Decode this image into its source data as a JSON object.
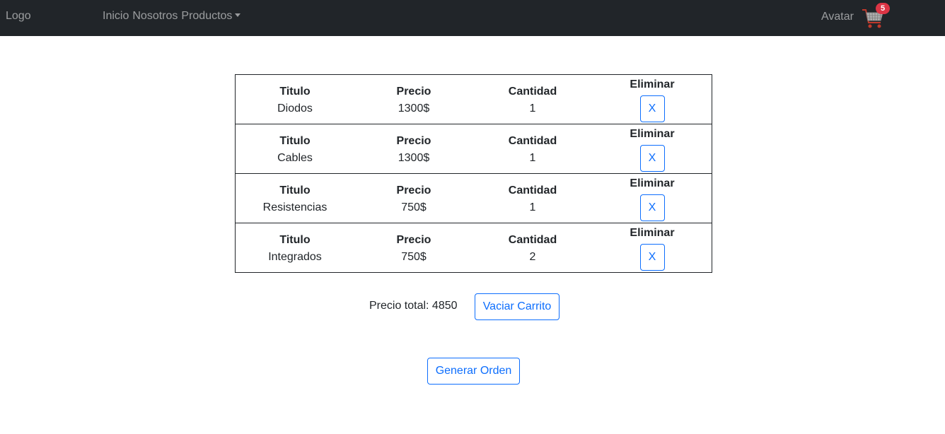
{
  "navbar": {
    "logo": "Logo",
    "links": [
      "Inicio",
      "Nosotros"
    ],
    "dropdown_label": "Productos",
    "avatar": "Avatar",
    "cart_count": "5"
  },
  "cart": {
    "headers": {
      "title": "Titulo",
      "price": "Precio",
      "qty": "Cantidad",
      "remove": "Eliminar"
    },
    "remove_label": "X",
    "items": [
      {
        "title": "Diodos",
        "price": "1300$",
        "qty": "1"
      },
      {
        "title": "Cables",
        "price": "1300$",
        "qty": "1"
      },
      {
        "title": "Resistencias",
        "price": "750$",
        "qty": "1"
      },
      {
        "title": "Integrados",
        "price": "750$",
        "qty": "2"
      }
    ]
  },
  "summary": {
    "total_label": "Precio total: 4850",
    "empty_button": "Vaciar Carrito",
    "order_button": "Generar Orden"
  },
  "colors": {
    "navbar_bg": "#212529",
    "primary": "#0d6efd",
    "badge": "#dc3545"
  }
}
